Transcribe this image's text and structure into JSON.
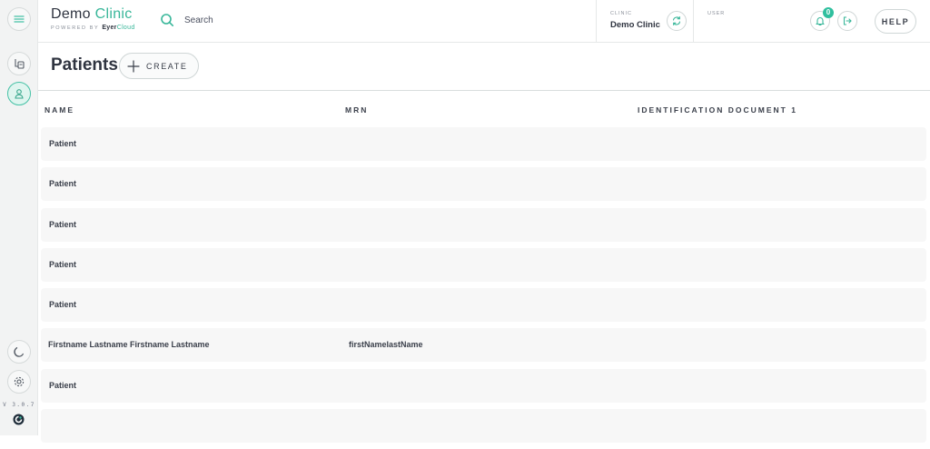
{
  "sidebar": {
    "items": [
      {
        "name": "menu-icon"
      },
      {
        "name": "worklist-icon"
      },
      {
        "name": "patient-icon",
        "active": true
      }
    ],
    "bottom": [
      {
        "name": "moon-icon"
      },
      {
        "name": "gear-icon"
      }
    ],
    "version": "V 3.0.7"
  },
  "header": {
    "brand_primary": "Demo",
    "brand_accent": "Clinic",
    "powered_by": "POWERED BY",
    "powered_brand": "Eyer",
    "powered_brand_accent": "Cloud",
    "search_placeholder": "Search",
    "clinic_label": "CLINIC",
    "clinic_name": "Demo Clinic",
    "user_label": "USER",
    "notification_count": "0",
    "help_label": "HELP"
  },
  "page": {
    "title": "Patients",
    "create_label": "CREATE"
  },
  "table": {
    "columns": [
      "NAME",
      "MRN",
      "IDENTIFICATION DOCUMENT 1"
    ],
    "rows": [
      {
        "name": "Patient",
        "mrn": "",
        "doc": ""
      },
      {
        "name": "Patient",
        "mrn": "",
        "doc": ""
      },
      {
        "name": "Patient",
        "mrn": "",
        "doc": ""
      },
      {
        "name": "Patient",
        "mrn": "",
        "doc": ""
      },
      {
        "name": "Patient",
        "mrn": "",
        "doc": ""
      },
      {
        "name": "Firstname Lastname Firstname Lastname",
        "mrn": "firstNamelastName",
        "doc": ""
      },
      {
        "name": "Patient",
        "mrn": "",
        "doc": ""
      },
      {
        "name": "",
        "mrn": "",
        "doc": ""
      }
    ]
  },
  "colors": {
    "accent": "#39b79a",
    "row_bg": "#f7f7f7",
    "rail_bg": "#f2f3f3"
  }
}
